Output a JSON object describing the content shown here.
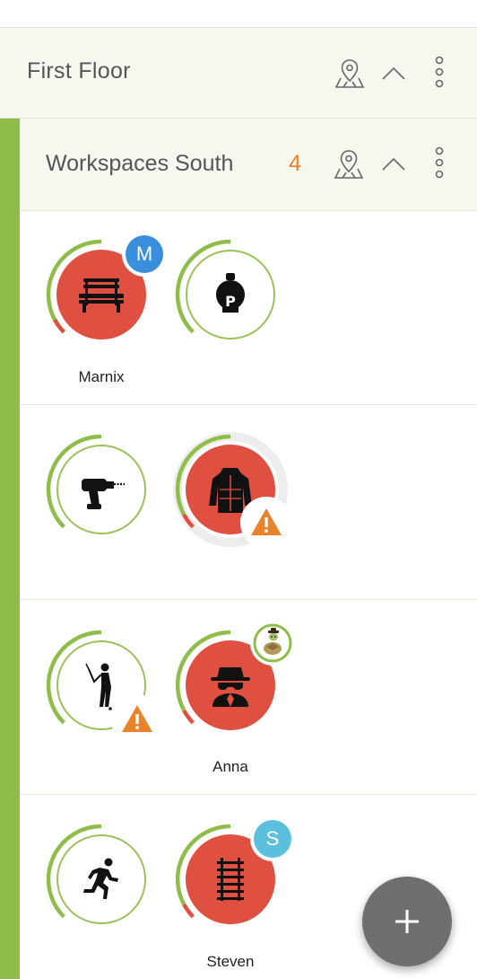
{
  "floor": {
    "title": "First Floor"
  },
  "group": {
    "title": "Workspaces South",
    "count": "4"
  },
  "colors": {
    "accent_green": "#8fbd4a",
    "busy_red": "#e05040",
    "warning_orange": "#e8832a",
    "avatar_blue": "#3a8fdc",
    "avatar_teal": "#5bc0de",
    "fab_gray": "#6f6f6f"
  },
  "rows": [
    {
      "workspaces": [
        {
          "icon": "bench-icon",
          "state": "occupied",
          "badge": "M",
          "name": "Marnix"
        },
        {
          "icon": "lightbulb-p-icon",
          "state": "free"
        }
      ]
    },
    {
      "workspaces": [
        {
          "icon": "drill-icon",
          "state": "free"
        },
        {
          "icon": "jacket-icon",
          "state": "occupied",
          "warning": true
        }
      ]
    },
    {
      "workspaces": [
        {
          "icon": "golfer-icon",
          "state": "free",
          "warning": true
        },
        {
          "icon": "spy-icon",
          "state": "occupied",
          "badge_image": "turtle-avatar",
          "name": "Anna"
        }
      ]
    },
    {
      "workspaces": [
        {
          "icon": "runner-icon",
          "state": "free"
        },
        {
          "icon": "railway-track-icon",
          "state": "occupied",
          "badge": "S",
          "name": "Steven"
        }
      ]
    }
  ],
  "fab": {
    "icon": "plus-icon"
  }
}
